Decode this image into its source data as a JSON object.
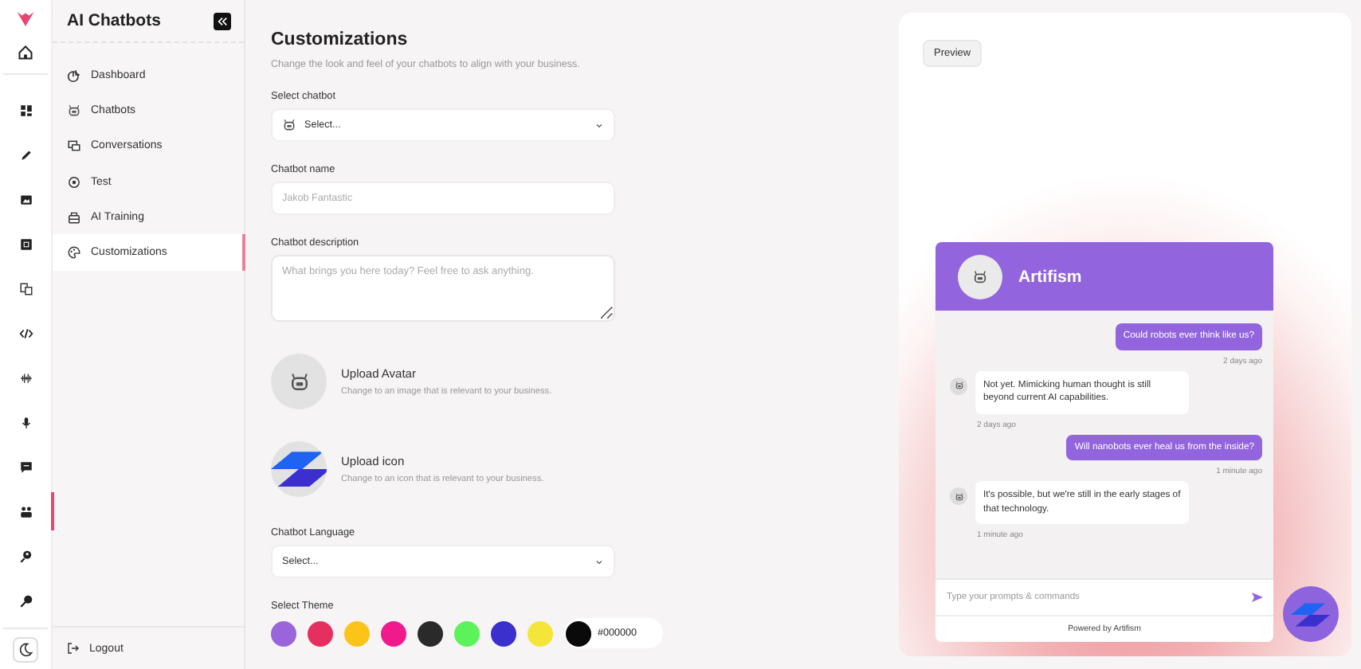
{
  "rail": {
    "items": [
      {
        "selected": false
      },
      {
        "selected": false
      },
      {
        "selected": false
      },
      {
        "selected": false
      },
      {
        "selected": false
      },
      {
        "selected": false
      },
      {
        "selected": false
      },
      {
        "selected": false
      },
      {
        "selected": false
      },
      {
        "selected": true
      },
      {
        "selected": false
      },
      {
        "selected": false
      }
    ]
  },
  "sidebar": {
    "title": "AI Chatbots",
    "items": [
      {
        "label": "Dashboard",
        "selected": false
      },
      {
        "label": "Chatbots",
        "selected": false
      },
      {
        "label": "Conversations",
        "selected": false
      },
      {
        "label": "Test",
        "selected": false
      },
      {
        "label": "AI Training",
        "selected": false
      },
      {
        "label": "Customizations",
        "selected": true
      }
    ],
    "logout": "Logout"
  },
  "main": {
    "title": "Customizations",
    "subtitle": "Change the look and feel of your chatbots to align with your business.",
    "fields": [
      {
        "kind": "bot_select",
        "label": "Select chatbot",
        "value": "Select..."
      },
      {
        "kind": "text",
        "label": "Chatbot name",
        "placeholder": "Jakob Fantastic"
      },
      {
        "kind": "textarea",
        "label": "Chatbot description",
        "placeholder": "What brings you here today? Feel free to ask anything."
      }
    ],
    "uploads": [
      {
        "kind": "avatar",
        "title": "Upload Avatar",
        "hint": "Change to an image that is relevant to your business."
      },
      {
        "kind": "icon",
        "title": "Upload icon",
        "hint": "Change to an icon that is relevant to your business."
      }
    ],
    "language": {
      "label": "Chatbot Language",
      "value": "Select..."
    },
    "theme": {
      "label": "Select Theme",
      "colors": [
        {
          "color": "#9a64da"
        },
        {
          "color": "#e5305f"
        },
        {
          "color": "#fcc419"
        },
        {
          "color": "#f01a8c"
        },
        {
          "color": "#2a2a2a"
        },
        {
          "color": "#5cf25a"
        },
        {
          "color": "#3b2fce"
        },
        {
          "color": "#f3e53a"
        }
      ],
      "custom": {
        "color": "#0a0a0a",
        "value": "#000000"
      }
    }
  },
  "preview": {
    "button": "Preview",
    "chat": {
      "name": "Artifism",
      "messages": [
        {
          "kind": "user",
          "text": "Could robots ever think like us?",
          "time": "2 days ago"
        },
        {
          "kind": "bot",
          "text": "Not yet. Mimicking human thought is still beyond current AI capabilities.",
          "time": "2 days ago"
        },
        {
          "kind": "user",
          "text": "Will nanobots ever heal us from the inside?",
          "time": "1 minute ago"
        },
        {
          "kind": "bot",
          "text": "It's possible, but we're still in the early stages of that technology.",
          "time": "1 minute ago"
        }
      ],
      "input_placeholder": "Type your prompts & commands",
      "footer": "Powered by Artifism"
    }
  }
}
